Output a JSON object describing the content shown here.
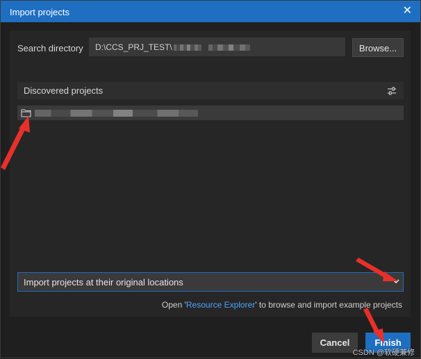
{
  "window": {
    "title": "Import projects",
    "close_icon": "close-icon"
  },
  "search": {
    "label": "Search directory",
    "value": "D:\\CCS_PRJ_TEST\\",
    "browse_label": "Browse..."
  },
  "discovered": {
    "header": "Discovered projects",
    "filter_icon": "sliders-icon",
    "items": [
      {
        "icon": "folder-icon",
        "name": ""
      }
    ]
  },
  "location": {
    "selected": "Import projects at their original locations"
  },
  "info": {
    "prefix": "Open '",
    "link": "Resource Explorer",
    "suffix": "' to browse and import example projects"
  },
  "footer": {
    "cancel_label": "Cancel",
    "finish_label": "Finish"
  },
  "watermark": "CSDN @软硬兼修",
  "colors": {
    "accent": "#1e6fc2",
    "link": "#4ea3ff",
    "annotation_arrow": "#e8302a"
  }
}
